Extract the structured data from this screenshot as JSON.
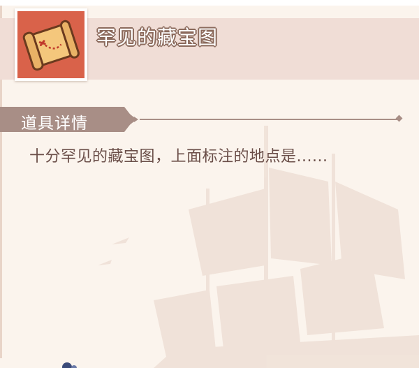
{
  "item": {
    "name": "罕见的藏宝图",
    "icon": "treasure-map-icon"
  },
  "section": {
    "label": "道具详情"
  },
  "description": "十分罕见的藏宝图，上面标注的地点是......",
  "colors": {
    "background": "#fbf4ed",
    "header_band": "#f0ddd6",
    "icon_box": "#d9624a",
    "tab": "#a88e86",
    "text": "#6a4e48"
  }
}
